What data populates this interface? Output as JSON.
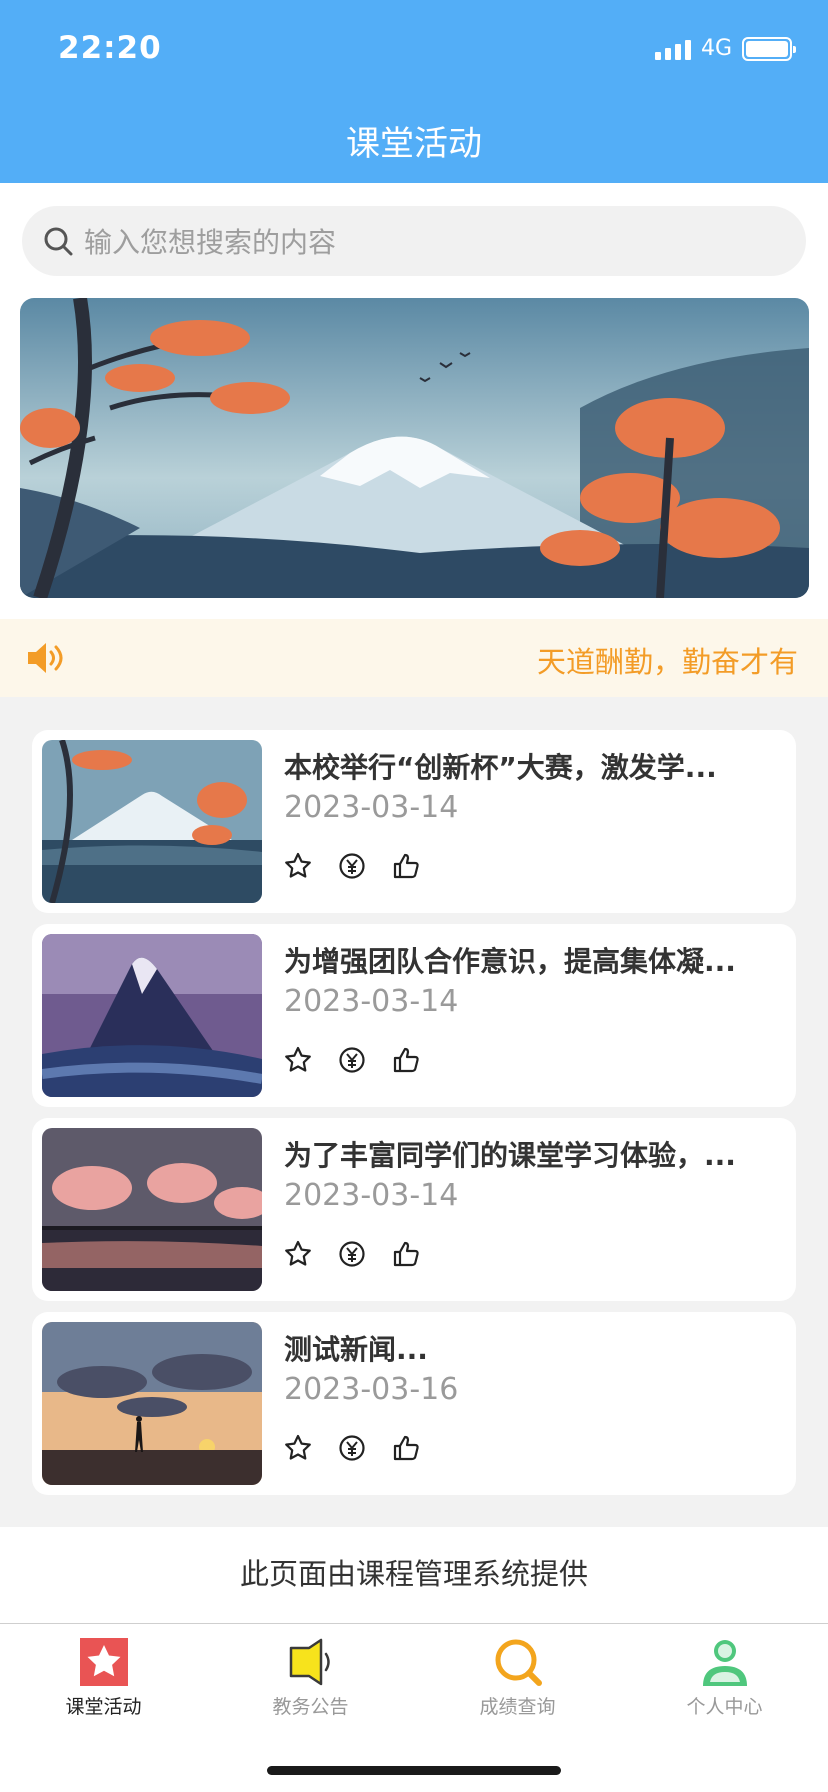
{
  "status_bar": {
    "time": "22:20",
    "network": "4G"
  },
  "header": {
    "title": "课堂活动"
  },
  "search": {
    "placeholder": "输入您想搜索的内容"
  },
  "notice": {
    "text": "天道酬勤，勤奋才有"
  },
  "news": [
    {
      "title": "本校举行“创新杯”大赛，激发学...",
      "date": "2023-03-14",
      "thumb_icon": "mountain-autumn-image"
    },
    {
      "title": "为增强团队合作意识，提高集体凝...",
      "date": "2023-03-14",
      "thumb_icon": "purple-peak-image"
    },
    {
      "title": "为了丰富同学们的课堂学习体验，...",
      "date": "2023-03-14",
      "thumb_icon": "sunset-clouds-image"
    },
    {
      "title": "测试新闻...",
      "date": "2023-03-16",
      "thumb_icon": "dusk-silhouette-image"
    }
  ],
  "news_actions": [
    "star-icon",
    "yen-coin-icon",
    "thumbs-up-icon"
  ],
  "footer": {
    "text": "此页面由课程管理系统提供"
  },
  "tabbar": {
    "items": [
      {
        "label": "课堂活动",
        "icon": "star-square-icon",
        "active": true
      },
      {
        "label": "教务公告",
        "icon": "speaker-icon",
        "active": false
      },
      {
        "label": "成绩查询",
        "icon": "search-icon",
        "active": false
      },
      {
        "label": "个人中心",
        "icon": "person-icon",
        "active": false
      }
    ]
  },
  "colors": {
    "header_bg": "#53aef7",
    "notice_text": "#f39c27",
    "notice_bg": "#fdf7ea",
    "tab_active_icon": "#e95454",
    "tab_speaker": "#f7e31c",
    "tab_search": "#f3a51d",
    "tab_person": "#4fc77d"
  }
}
